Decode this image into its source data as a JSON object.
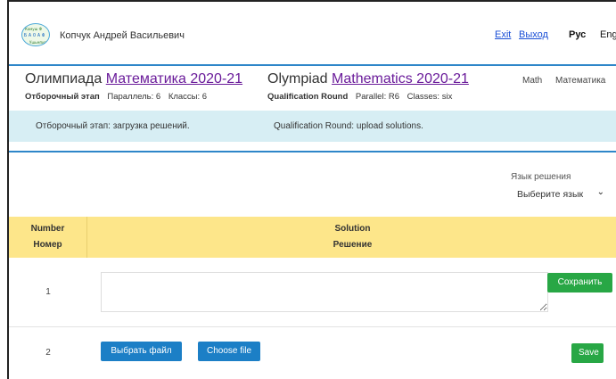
{
  "header": {
    "logo_text": [
      "Комуш Ф",
      "Б А О А Ф",
      "Ушьмпиад"
    ],
    "user_name": "Копчук Андрей Васильевич",
    "exit_en": "Exit",
    "exit_ru": "Выход",
    "lang_ru": "Рус",
    "lang_en": "Eng"
  },
  "olympiad": {
    "ru": {
      "prefix": "Олимпиада",
      "link": "Математика 2020-21",
      "stage": "Отборочный этап",
      "parallel": "Параллель: 6",
      "classes": "Классы: 6"
    },
    "en": {
      "prefix": "Olympiad",
      "link": "Mathematics 2020-21",
      "stage": "Qualification Round",
      "parallel": "Parallel: R6",
      "classes": "Classes: six"
    },
    "subject_en": "Math",
    "subject_ru": "Математика"
  },
  "info_band": {
    "ru": "Отборочный этап: загрузка решений.",
    "en": "Qualification Round: upload solutions."
  },
  "solution_language": {
    "label": "Язык решения",
    "selected": "Выберите язык"
  },
  "table": {
    "col_number_en": "Number",
    "col_number_ru": "Номер",
    "col_solution_en": "Solution",
    "col_solution_ru": "Решение",
    "rows": [
      {
        "number": "1",
        "save_label": "Сохранить"
      },
      {
        "number": "2",
        "choose_ru": "Выбрать файл",
        "choose_en": "Choose file",
        "save_label": "Save"
      }
    ]
  }
}
